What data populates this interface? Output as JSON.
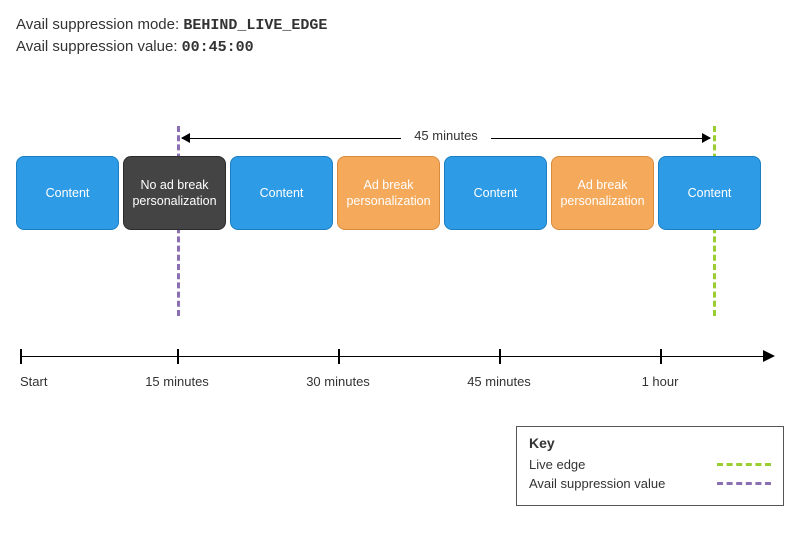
{
  "header": {
    "mode_label": "Avail suppression mode:",
    "mode_value": "BEHIND_LIVE_EDGE",
    "value_label": "Avail suppression value:",
    "value_value": "00:45:00"
  },
  "span_label": "45 minutes",
  "blocks": [
    {
      "label": "Content",
      "style": "blue"
    },
    {
      "label": "No ad break personalization",
      "style": "dark"
    },
    {
      "label": "Content",
      "style": "blue"
    },
    {
      "label": "Ad break personalization",
      "style": "orange"
    },
    {
      "label": "Content",
      "style": "blue"
    },
    {
      "label": "Ad break personalization",
      "style": "orange"
    },
    {
      "label": "Content",
      "style": "blue"
    }
  ],
  "timeline": {
    "ticks": [
      {
        "pos": 4,
        "label": "Start"
      },
      {
        "pos": 161,
        "label": "15 minutes"
      },
      {
        "pos": 322,
        "label": "30 minutes"
      },
      {
        "pos": 483,
        "label": "45 minutes"
      },
      {
        "pos": 644,
        "label": "1 hour"
      }
    ]
  },
  "legend": {
    "title": "Key",
    "items": [
      {
        "label": "Live edge",
        "color": "green"
      },
      {
        "label": "Avail suppression value",
        "color": "purple"
      }
    ]
  }
}
